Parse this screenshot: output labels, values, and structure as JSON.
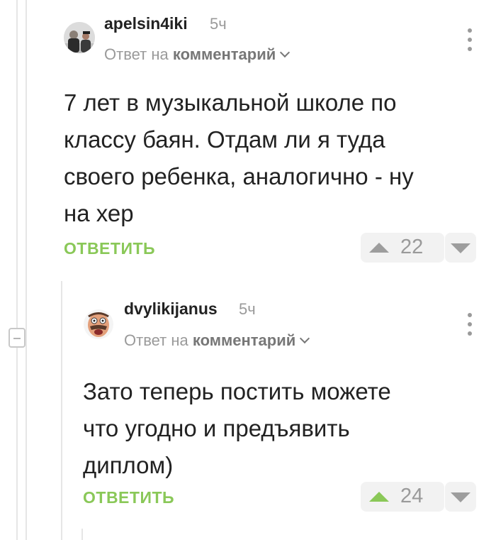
{
  "comments": [
    {
      "username": "apelsin4iki",
      "time": "5ч",
      "reply_prefix": "Ответ на",
      "reply_target": "комментарий",
      "text_lines": [
        "7 лет в музыкальной школе по",
        "классу баян. Отдам ли я туда",
        "своего ребенка, аналогично - ну",
        "на хер"
      ],
      "reply_label": "ОТВЕТИТЬ",
      "rating": "22",
      "upvoted": false,
      "avatar_icon": "user-photo-avatar"
    },
    {
      "username": "dvylikijanus",
      "time": "5ч",
      "reply_prefix": "Ответ на",
      "reply_target": "комментарий",
      "text_lines": [
        "Зато теперь постить можете",
        "что угодно и предъявить",
        "диплом)"
      ],
      "reply_label": "ОТВЕТИТЬ",
      "rating": "24",
      "upvoted": true,
      "avatar_icon": "cartoon-face-avatar"
    }
  ],
  "colors": {
    "accent_green": "#8ac858",
    "muted_gray": "#9a9a9a",
    "thread_line": "#e6e6e6"
  }
}
